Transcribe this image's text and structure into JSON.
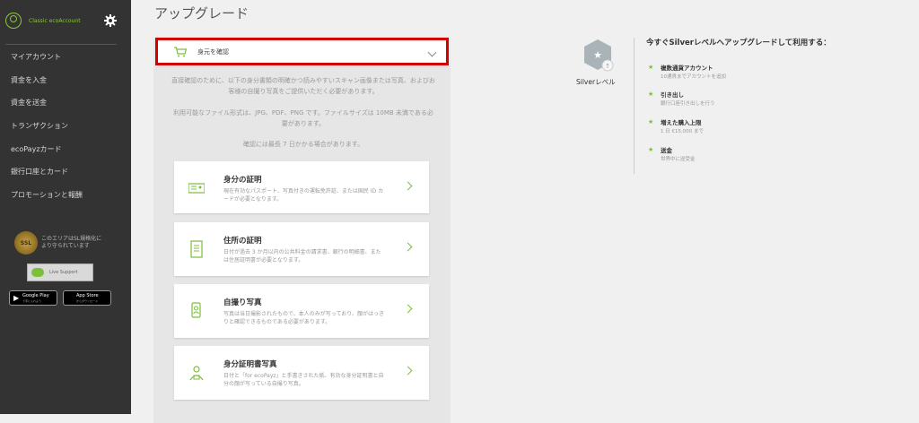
{
  "sidebar": {
    "account_name": "Classic ecoAccount",
    "nav": [
      "マイアカウント",
      "資金を入金",
      "資金を送金",
      "トランザクション",
      "ecoPayzカード",
      "銀行口座とカード",
      "プロモーションと報酬"
    ],
    "protection_text": "このエリアはSL規格化により守られています",
    "seal_text": "SSL",
    "live_support": "Live Support",
    "google_play": {
      "line1": "Google Play",
      "line2": "で手に入れよう"
    },
    "app_store": {
      "line1": "App Store",
      "line2": "からダウンロード"
    }
  },
  "main": {
    "title": "アップグレード",
    "dropdown_label": "身元を確認",
    "description_1": "直接確認のために、以下の身分書類の明確かつ読みやすいスキャン画像または写真、およびお客様の自撮り写真をご提供いただく必要があります。",
    "description_2": "利用可能なファイル形式は、JPG、PDF、PNG です。ファイルサイズは 10MB 未満である必要があります。",
    "description_3": "確認には最長 7 日かかる場合があります。",
    "documents": [
      {
        "title": "身分の証明",
        "desc": "現在有効なパスポート、写真付きの運転免許証、または国民 ID カードが必要となります。",
        "icon": "id-card-icon"
      },
      {
        "title": "住所の証明",
        "desc": "日付が過去 3 か月以内の公共料金の請求書、銀行の明細書、または住居証明書が必要となります。",
        "icon": "document-icon"
      },
      {
        "title": "自撮り写真",
        "desc": "写真は当日撮影されたもので、本人のみが写っており、顔がはっきりと確認できるものである必要があります。",
        "icon": "selfie-icon"
      },
      {
        "title": "身分証明書写真",
        "desc": "日付と「for ecoPayz」と手書きされた紙、有効な身分証明書と自分の顔が写っている自撮り写真。",
        "icon": "person-id-icon"
      }
    ]
  },
  "right": {
    "level_label": "Silverレベル",
    "benefit_title": "今すぐSilverレベルへアップグレードして利用する：",
    "benefits": [
      {
        "title": "複数通貨アカウント",
        "sub": "10通貨までアカウントを追加"
      },
      {
        "title": "引き出し",
        "sub": "銀行口座引き出しを行う"
      },
      {
        "title": "増えた購入上限",
        "sub": "1 日 €15,000 まで"
      },
      {
        "title": "送金",
        "sub": "世界中に送受金"
      }
    ]
  },
  "colors": {
    "sidebar_bg": "#333333",
    "accent_green": "#7cbf3b",
    "highlight_red": "#d40000"
  }
}
